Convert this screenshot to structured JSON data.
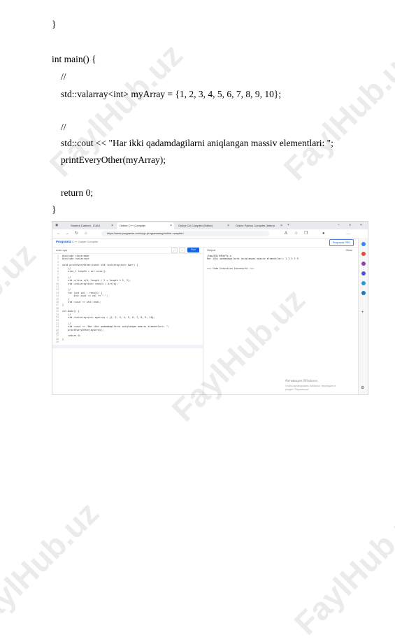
{
  "document": {
    "code_lines": [
      "}",
      "int main() {",
      "//",
      "std::valarray<int> myArray = {1, 2, 3, 4, 5, 6, 7, 8, 9, 10};",
      "//",
      "std::cout << \"Har ikki qadamdagilarni aniqlangan massiv elementlari: \";",
      "printEveryOther(myArray);",
      "return 0;",
      "}"
    ],
    "watermark": "FaylHub.uz"
  },
  "screenshot": {
    "tabs": [
      "Student Cabinet - EJAS",
      "Online C++ Compiler",
      "Online C# Compiler (Editor)",
      "Online Python Compiler (Interpr"
    ],
    "url": "https://www.programiz.com/cpp-programming/online-compiler/",
    "logo": "Programiz",
    "breadcrumb": "C++ Online Compiler",
    "pro_button": "Programiz PRO",
    "file_name": "main.cpp",
    "run_label": "Run",
    "output_title": "Output",
    "clear_label": "Clear",
    "editor_lines": [
      "#include <iostream>",
      "#include <valarray>",
      "",
      "void printEveryOther(const std::valarray<int> &arr) {",
      "    //",
      "    size_t length = arr.size();",
      "",
      "    //",
      "    std::slice s(0, length / 2 + length % 2, 2);",
      "    std::valarray<int> result = arr[s];",
      "",
      "    //",
      "    for (int val : result) {",
      "        std::cout << val << \" \";",
      "    }",
      "    std::cout << std::endl;",
      "}",
      "",
      "int main() {",
      "    //",
      "    std::valarray<int> myArray = {1, 2, 3, 4, 5, 6, 7, 8, 9, 10};",
      "",
      "    //",
      "    std::cout << \"Har ikki qadamdagilarni aniqlangan massiv elementlari: \";",
      "    printEveryOther(myArray);",
      "",
      "    return 0;",
      "}",
      ""
    ],
    "line_numbers": [
      "1",
      "2",
      "3",
      "4",
      "5",
      "6",
      "7",
      "8",
      "9",
      "10",
      "11",
      "12",
      "13",
      "14",
      "15",
      "16",
      "17",
      "18",
      "19",
      "20",
      "21",
      "22",
      "23",
      "24",
      "25",
      "26",
      "27",
      "28",
      "29"
    ],
    "output_lines": [
      "/tmp/N3ilH9eVTx.o",
      "Har ikki qadamdagilarni aniqlangan massiv elementlari: 1 3 5 7 9",
      "",
      "",
      "=== Code Execution Successful ==="
    ],
    "activation_title": "Активация Windows",
    "activation_text_1": "Чтобы активировать Windows, перейдите в",
    "activation_text_2": "раздел \"Параметры\"."
  }
}
